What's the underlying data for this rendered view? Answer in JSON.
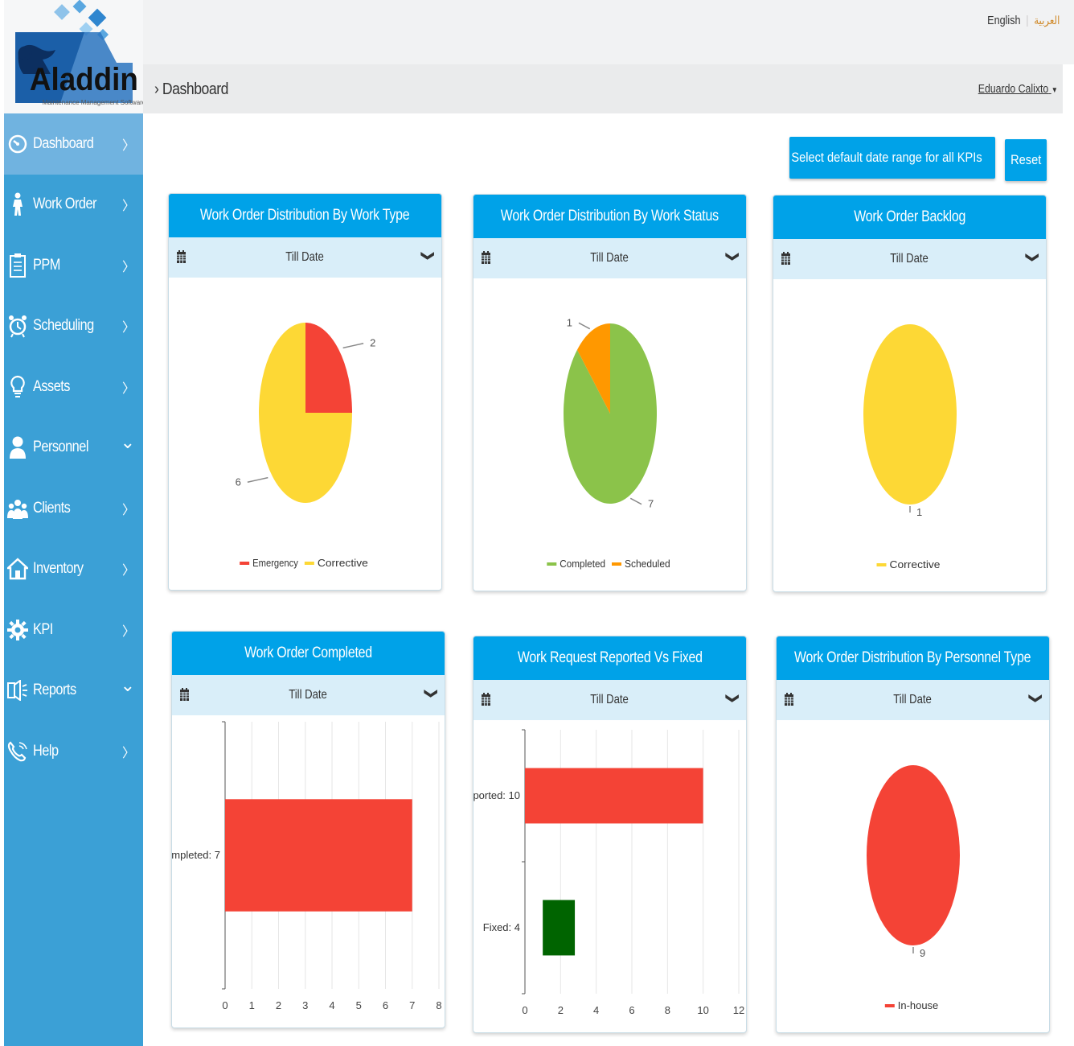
{
  "logo": {
    "name": "Aladdin",
    "tagline": "Maintenance Management Software"
  },
  "language": {
    "english": "English",
    "arabic": "العربية"
  },
  "breadcrumb": "Dashboard",
  "user": "Eduardo Calixto",
  "nav": [
    {
      "label": "Dashboard",
      "icon": "dashboard-icon",
      "arrow": "right",
      "active": true
    },
    {
      "label": "Work Order",
      "icon": "worker-icon",
      "arrow": "right"
    },
    {
      "label": "PPM",
      "icon": "clipboard-icon",
      "arrow": "right"
    },
    {
      "label": "Scheduling",
      "icon": "alarm-clock-icon",
      "arrow": "right"
    },
    {
      "label": "Assets",
      "icon": "lightbulb-icon",
      "arrow": "right"
    },
    {
      "label": "Personnel",
      "icon": "person-icon",
      "arrow": "down"
    },
    {
      "label": "Clients",
      "icon": "group-icon",
      "arrow": "right"
    },
    {
      "label": "Inventory",
      "icon": "home-icon",
      "arrow": "right"
    },
    {
      "label": "KPI",
      "icon": "gear-icon",
      "arrow": "right"
    },
    {
      "label": "Reports",
      "icon": "speaker-icon",
      "arrow": "down"
    },
    {
      "label": "Help",
      "icon": "phone-icon",
      "arrow": "right"
    }
  ],
  "toolbar": {
    "date_range_label": "Select default date range for all KPIs",
    "reset_label": "Reset"
  },
  "colors": {
    "accent": "#00a2e8",
    "red": "#f44336",
    "yellow": "#fdd835",
    "green": "#8bc34a",
    "orange": "#ff9800",
    "darkgreen": "#006400"
  },
  "cards": [
    {
      "title": "Work Order Distribution By Work Type",
      "filter": "Till Date"
    },
    {
      "title": "Work Order Distribution By Work Status",
      "filter": "Till Date"
    },
    {
      "title": "Work Order Backlog",
      "filter": "Till Date"
    },
    {
      "title": "Work Order Completed",
      "filter": "Till Date"
    },
    {
      "title": "Work Request Reported Vs Fixed",
      "filter": "Till Date"
    },
    {
      "title": "Work Order Distribution By Personnel Type",
      "filter": "Till Date"
    }
  ],
  "chart_data": [
    {
      "type": "pie",
      "title": "Work Order Distribution By Work Type",
      "slices": [
        {
          "name": "Emergency",
          "value": 2,
          "color": "#f44336"
        },
        {
          "name": "Corrective",
          "value": 6,
          "color": "#fdd835"
        }
      ],
      "legend": "bottom"
    },
    {
      "type": "pie",
      "title": "Work Order Distribution By Work Status",
      "slices": [
        {
          "name": "Completed",
          "value": 7,
          "color": "#8bc34a"
        },
        {
          "name": "Scheduled",
          "value": 1,
          "color": "#ff9800"
        }
      ],
      "legend": "bottom"
    },
    {
      "type": "pie",
      "title": "Work Order Backlog",
      "slices": [
        {
          "name": "Corrective",
          "value": 1,
          "color": "#fdd835"
        }
      ],
      "legend": "bottom"
    },
    {
      "type": "bar",
      "orientation": "horizontal",
      "title": "Work Order Completed",
      "categories": [
        "Completed"
      ],
      "values": [
        7
      ],
      "colors": [
        "#f44336"
      ],
      "xlim": [
        0,
        8
      ],
      "xticks": [
        0,
        1,
        2,
        3,
        4,
        5,
        6,
        7,
        8
      ],
      "grid": true
    },
    {
      "type": "bar",
      "orientation": "horizontal",
      "title": "Work Request Reported Vs Fixed",
      "categories": [
        "Reported",
        "Fixed"
      ],
      "values": [
        10,
        4
      ],
      "colors": [
        "#f44336",
        "#006400"
      ],
      "xlim": [
        0,
        12
      ],
      "xticks": [
        0,
        2,
        4,
        6,
        8,
        10,
        12
      ],
      "grid": true
    },
    {
      "type": "pie",
      "title": "Work Order Distribution By Personnel Type",
      "slices": [
        {
          "name": "In-house",
          "value": 9,
          "color": "#f44336"
        }
      ],
      "legend": "bottom"
    }
  ]
}
